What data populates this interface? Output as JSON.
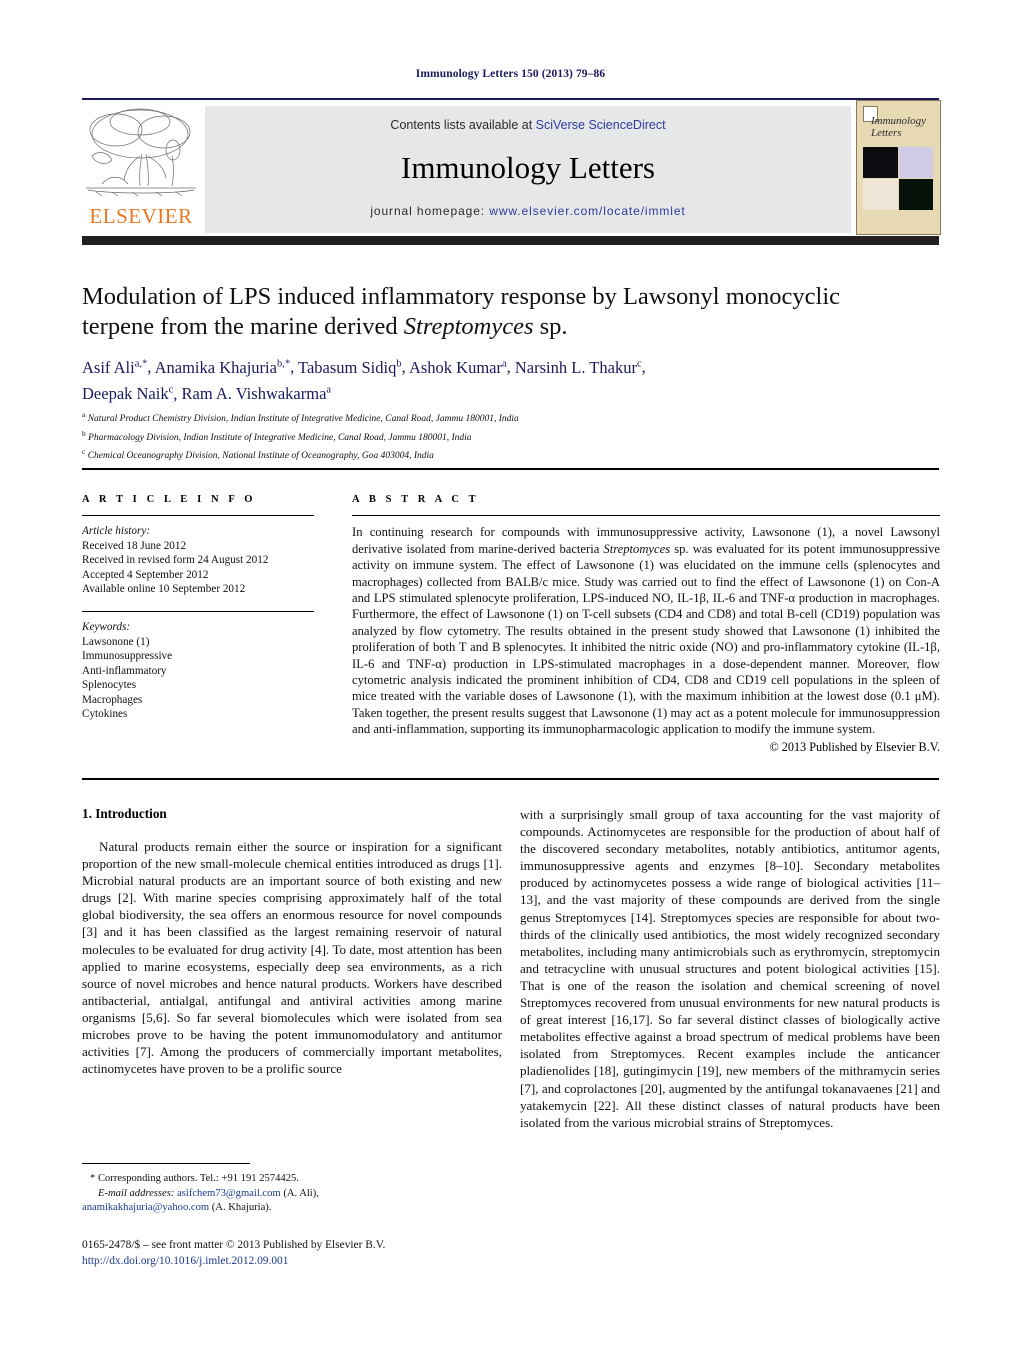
{
  "running_head": "Immunology Letters 150 (2013) 79–86",
  "masthead": {
    "contents_prefix": "Contents lists available at ",
    "contents_link": "SciVerse ScienceDirect",
    "journal_title": "Immunology Letters",
    "homepage_prefix": "journal homepage: ",
    "homepage_url": "www.elsevier.com/locate/immlet",
    "publisher_logo_text": "ELSEVIER",
    "cover_journal_name": "Immunology Letters",
    "band_color": "#e6e7e8",
    "rule_color": "#1a1a5e",
    "elsevier_orange": "#E87722"
  },
  "article": {
    "title_line1": "Modulation of LPS induced inflammatory response by Lawsonyl monocyclic",
    "title_line2_pre": "terpene from the marine derived ",
    "title_line2_italic": "Streptomyces",
    "title_line2_post": " sp.",
    "authors": [
      {
        "name": "Asif Ali",
        "sup": "a,*"
      },
      {
        "name": "Anamika Khajuria",
        "sup": "b,*"
      },
      {
        "name": "Tabasum Sidiq",
        "sup": "b"
      },
      {
        "name": "Ashok Kumar",
        "sup": "a"
      },
      {
        "name": "Narsinh L. Thakur",
        "sup": "c"
      },
      {
        "name": "Deepak Naik",
        "sup": "c"
      },
      {
        "name": "Ram A. Vishwakarma",
        "sup": "a"
      }
    ],
    "affiliations": [
      {
        "marker": "a",
        "text": "Natural Product Chemistry Division, Indian Institute of Integrative Medicine, Canal Road, Jammu 180001, India"
      },
      {
        "marker": "b",
        "text": "Pharmacology Division, Indian Institute of Integrative Medicine, Canal Road, Jammu 180001, India"
      },
      {
        "marker": "c",
        "text": "Chemical Oceanography Division, National Institute of Oceanography, Goa 403004, India"
      }
    ]
  },
  "article_info": {
    "heading": "A R T I C L E   I N F O",
    "history_label": "Article history:",
    "history": [
      "Received 18 June 2012",
      "Received in revised form 24 August 2012",
      "Accepted 4 September 2012",
      "Available online 10 September 2012"
    ],
    "keywords_label": "Keywords:",
    "keywords": [
      "Lawsonone (1)",
      "Immunosuppressive",
      "Anti-inflammatory",
      "Splenocytes",
      "Macrophages",
      "Cytokines"
    ]
  },
  "abstract": {
    "heading": "A B S T R A C T",
    "part1": "In continuing research for compounds with immunosuppressive activity, Lawsonone (1), a novel Lawsonyl derivative isolated from marine-derived bacteria ",
    "italic1": "Streptomyces",
    "part2": " sp. was evaluated for its potent immunosuppressive activity on immune system. The effect of Lawsonone (1) was elucidated on the immune cells (splenocytes and macrophages) collected from BALB/c mice. Study was carried out to find the effect of Lawsonone (1) on Con-A and LPS stimulated splenocyte proliferation, LPS-induced NO, IL-1β, IL-6 and TNF-α production in macrophages. Furthermore, the effect of Lawsonone (1) on T-cell subsets (CD4 and CD8) and total B-cell (CD19) population was analyzed by flow cytometry. The results obtained in the present study showed that Lawsonone (1) inhibited the proliferation of both T and B splenocytes. It inhibited the nitric oxide (NO) and pro-inflammatory cytokine (IL-1β, IL-6 and TNF-α) production in LPS-stimulated macrophages in a dose-dependent manner. Moreover, flow cytometric analysis indicated the prominent inhibition of CD4, CD8 and CD19 cell populations in the spleen of mice treated with the variable doses of Lawsonone (1), with the maximum inhibition at the lowest dose (0.1 μM). Taken together, the present results suggest that Lawsonone (1) may act as a potent molecule for immunosuppression and anti-inflammation, supporting its immunopharmacologic application to modify the immune system.",
    "copyright": "© 2013 Published by Elsevier B.V."
  },
  "body": {
    "section_number_title": "1.  Introduction",
    "left_par_a": "Natural products remain either the source or inspiration for a significant proportion of the new small-molecule chemical entities introduced as drugs [1]. Microbial natural products are an important source of both existing and new drugs [2]. With marine species comprising approximately half of the total global biodiversity, the sea offers an enormous resource for novel compounds [3] and it has been classified as the largest remaining reservoir of natural molecules to be evaluated for drug activity [4]. To date, most attention has been applied to marine ecosystems, especially deep sea environments, as a rich source of novel microbes and hence natural products. Workers have described antibacterial, antialgal, antifungal and antiviral activities among marine organisms [5,6]. So far several biomolecules which were isolated from sea microbes prove to be having the potent immunomodulatory and antitumor activities [7]. Among the producers of commercially important metabolites, actinomycetes have proven to be a prolific source",
    "right_par_a": "with a surprisingly small group of taxa accounting for the vast majority of compounds. Actinomycetes are responsible for the production of about half of the discovered secondary metabolites, notably antibiotics, antitumor agents, immunosuppressive agents and enzymes [8–10]. Secondary metabolites produced by actinomycetes possess a wide range of biological activities [11–13], and the vast majority of these compounds are derived from the single genus Streptomyces [14]. Streptomyces species are responsible for about two-thirds of the clinically used antibiotics, the most widely recognized secondary metabolites, including many antimicrobials such as erythromycin, streptomycin and tetracycline with unusual structures and potent biological activities [15]. That is one of the reason the isolation and chemical screening of novel Streptomyces recovered from unusual environments for new natural products is of great interest [16,17]. So far several distinct classes of biologically active metabolites effective against a broad spectrum of medical problems have been isolated from Streptomyces. Recent examples include the anticancer pladienolides [18], gutingimycin [19], new members of the mithramycin series [7], and coprolactones [20], augmented by the antifungal tokanavaenes [21] and yatakemycin [22]. All these distinct classes of natural products have been isolated from the various microbial strains of Streptomyces."
  },
  "footnotes": {
    "corresponding": "* Corresponding authors. Tel.: +91 191 2574425.",
    "email_label": "E-mail addresses:",
    "email1": "asifchem73@gmail.com",
    "email1_owner": " (A. Ali),",
    "email2": "anamikakhajuria@yahoo.com",
    "email2_owner": " (A. Khajuria).",
    "issn_line": "0165-2478/$ – see front matter © 2013 Published by Elsevier B.V.",
    "doi_line": "http://dx.doi.org/10.1016/j.imlet.2012.09.001"
  }
}
